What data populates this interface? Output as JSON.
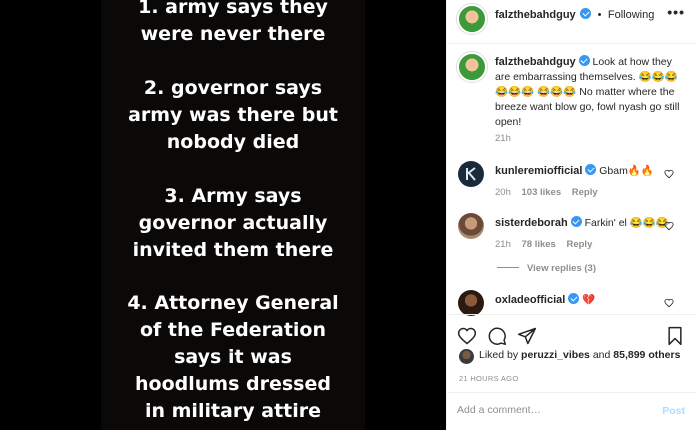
{
  "story": {
    "lines": [
      "1. army says they",
      "were never there",
      "2. governor says",
      "army was there but",
      "nobody died",
      "3. Army says",
      "governor actually",
      "invited them there",
      "4. Attorney General",
      "of the Federation",
      "says it was",
      "hoodlums dressed",
      "in military attire"
    ]
  },
  "header": {
    "username": "falzthebahdguy",
    "separator": "•",
    "follow_label": "Following",
    "more_label": "•••"
  },
  "caption": {
    "username": "falzthebahdguy",
    "text": "Look at how they are embarrassing themselves. 😂😂😂 😂😂😂 😂😂😂 No matter where the breeze want blow go, fowl nyash go still open!",
    "time": "21h"
  },
  "comments": [
    {
      "username": "kunleremiofficial",
      "text": "Gbam🔥🔥",
      "time": "20h",
      "likes": "103 likes",
      "reply": "Reply"
    },
    {
      "username": "sisterdeborah",
      "text": "Farkin' el 😂😂😂",
      "time": "21h",
      "likes": "78 likes",
      "reply": "Reply",
      "view_replies": "View replies (3)"
    },
    {
      "username": "oxladeofficial",
      "text": "💔"
    }
  ],
  "likes": {
    "prefix": "Liked by",
    "user": "peruzzi_vibes",
    "middle": "and",
    "others": "85,899 others"
  },
  "post_time": "21 HOURS AGO",
  "add_comment": {
    "placeholder": "Add a comment…",
    "post_label": "Post"
  },
  "colors": {
    "verified": "#3897f0",
    "muted": "#8e8e8e",
    "post_disabled": "#b3dbff"
  }
}
